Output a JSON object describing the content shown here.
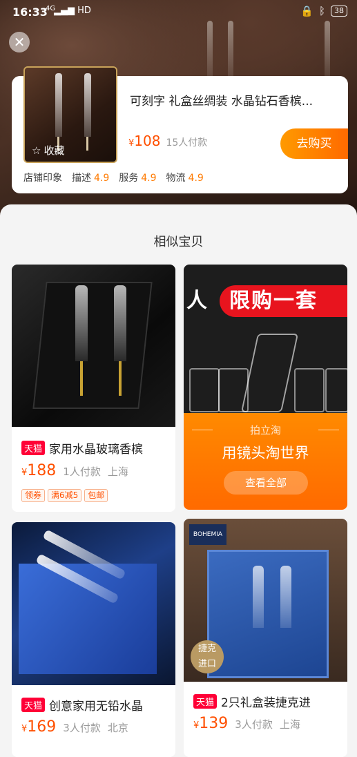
{
  "status": {
    "time": "16:33",
    "network": "4G",
    "battery": "38"
  },
  "product": {
    "favorite_label": "收藏",
    "title": "可刻字 礼盒丝绸装 水晶钻石香槟...",
    "currency": "¥",
    "price": "108",
    "paid": "15人付款",
    "buy_label": "去购买",
    "shop_label": "店铺印象",
    "ratings": [
      {
        "label": "描述",
        "value": "4.9"
      },
      {
        "label": "服务",
        "value": "4.9"
      },
      {
        "label": "物流",
        "value": "4.9"
      }
    ]
  },
  "section_title": "相似宝贝",
  "items": [
    {
      "badge": "天猫",
      "name": "家用水晶玻璃香槟",
      "currency": "¥",
      "price": "188",
      "paid": "1人付款",
      "location": "上海",
      "tags": [
        "领券",
        "满6减5",
        "包邮"
      ]
    },
    {
      "badge": "天猫",
      "name": "创意家用无铅水晶",
      "currency": "¥",
      "price": "169",
      "paid": "3人付款",
      "location": "北京"
    },
    {
      "badge": "天猫",
      "name": "2只礼盒装捷克进",
      "currency": "¥",
      "price": "139",
      "paid": "3人付款",
      "location": "上海",
      "img_brand": "BOHEMIA",
      "img_seal": "捷克\n进口"
    }
  ],
  "promo": {
    "banner_left": "人",
    "banner": "限购一套",
    "sub": "拍立淘",
    "main": "用镜头淘世界",
    "button": "查看全部"
  }
}
